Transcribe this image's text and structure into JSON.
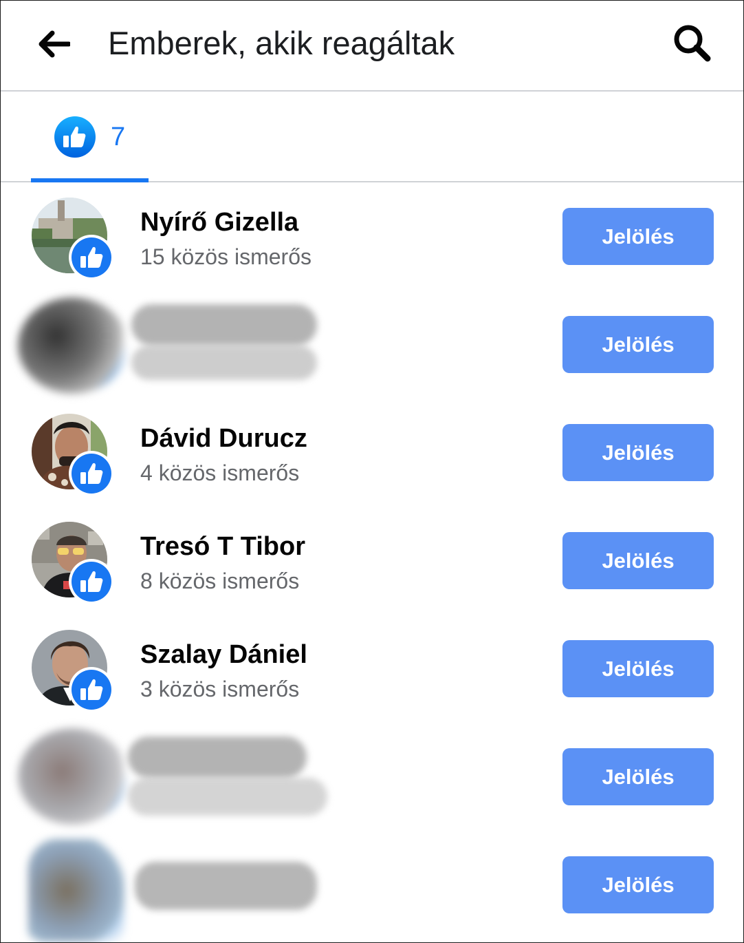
{
  "header": {
    "title": "Emberek, akik reagáltak",
    "back_icon": "arrow-left-icon",
    "search_icon": "search-icon"
  },
  "tabs": [
    {
      "icon": "like-icon",
      "count": "7",
      "active": true
    }
  ],
  "colors": {
    "accent": "#1877f2",
    "button": "#5b91f5",
    "muted_text": "#65676b"
  },
  "people": [
    {
      "name": "Nyírő Gizella",
      "mutual": "15 közös ismerős",
      "button": "Jelölés",
      "hidden": false
    },
    {
      "name": "",
      "mutual": "",
      "button": "Jelölés",
      "hidden": true
    },
    {
      "name": "Dávid Durucz",
      "mutual": "4 közös ismerős",
      "button": "Jelölés",
      "hidden": false
    },
    {
      "name": "Tresó T Tibor",
      "mutual": "8 közös ismerős",
      "button": "Jelölés",
      "hidden": false
    },
    {
      "name": "Szalay Dániel",
      "mutual": "3 közös ismerős",
      "button": "Jelölés",
      "hidden": false
    },
    {
      "name": "",
      "mutual": "",
      "button": "Jelölés",
      "hidden": true
    },
    {
      "name": "",
      "mutual": "",
      "button": "Jelölés",
      "hidden": true
    }
  ]
}
